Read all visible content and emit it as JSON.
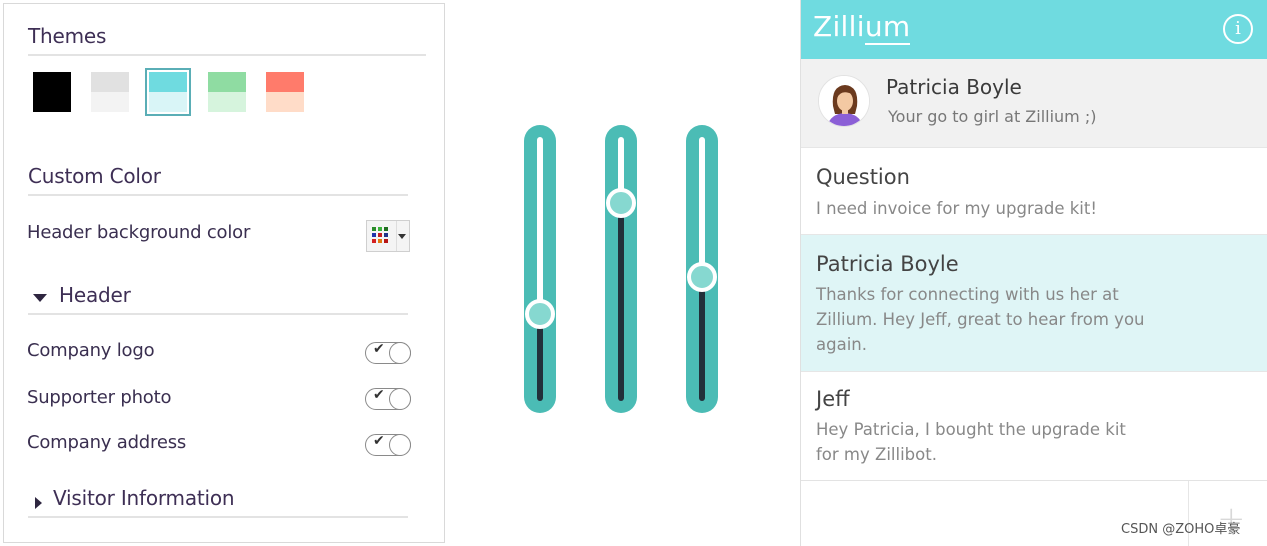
{
  "settings": {
    "themes_title": "Themes",
    "themes": [
      {
        "name": "black",
        "top": "#000000",
        "bottom": "#000000",
        "selected": false
      },
      {
        "name": "grey",
        "top": "#e1e1e1",
        "bottom": "#f3f3f3",
        "selected": false
      },
      {
        "name": "cyan",
        "top": "#6fdbe0",
        "bottom": "#d9f5f7",
        "selected": true
      },
      {
        "name": "green",
        "top": "#8fdca2",
        "bottom": "#d6f4dd",
        "selected": false
      },
      {
        "name": "coral",
        "top": "#ff7b6b",
        "bottom": "#ffdcc8",
        "selected": false
      }
    ],
    "custom_color_title": "Custom Color",
    "header_bg_label": "Header background color",
    "header_section": "Header",
    "toggles": [
      {
        "label": "Company logo",
        "on": true
      },
      {
        "label": "Supporter photo",
        "on": true
      },
      {
        "label": "Company address",
        "on": true
      }
    ],
    "visitor_section": "Visitor Information"
  },
  "sliders": {
    "accent": "#4bbcb5",
    "values": [
      0.33,
      0.75,
      0.47
    ]
  },
  "chat": {
    "brand": "Zillium",
    "info_icon": "info-icon",
    "header_color": "#6fdbe0",
    "agent": {
      "name": "Patricia Boyle",
      "tagline": "Your go to girl at Zillium ;)"
    },
    "messages": [
      {
        "sender": "Question",
        "text": "I need invoice for my upgrade kit!",
        "highlight": false
      },
      {
        "sender": "Patricia Boyle",
        "text": "Thanks for connecting with us her at Zillium. Hey Jeff, great to hear from you again.",
        "highlight": true
      },
      {
        "sender": "Jeff",
        "text": "Hey Patricia, I bought the upgrade kit for my Zillibot.",
        "highlight": false
      }
    ],
    "add_icon": "plus-icon",
    "add_symbol": "+"
  },
  "watermark": "CSDN @ZOHO卓豪"
}
